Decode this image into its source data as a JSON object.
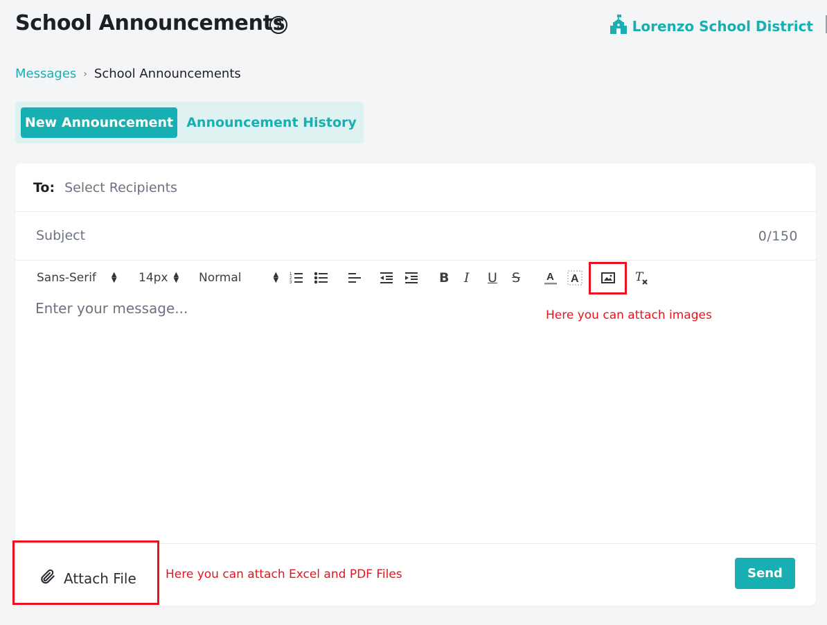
{
  "header": {
    "title": "School Announcements",
    "help_icon": "question-circle-icon",
    "district_name": "Lorenzo School District",
    "district_icon": "school-building-icon"
  },
  "breadcrumb": {
    "parent": "Messages",
    "separator": "›",
    "current": "School Announcements"
  },
  "tabs": [
    {
      "label": "New Announcement",
      "active": true
    },
    {
      "label": "Announcement History",
      "active": false
    }
  ],
  "form": {
    "to_label": "To:",
    "to_placeholder": "Select Recipients",
    "subject_placeholder": "Subject",
    "subject_counter": "0/150",
    "message_placeholder": "Enter your message..."
  },
  "toolbar": {
    "font_family": "Sans-Serif",
    "font_size": "14px",
    "heading": "Normal",
    "icons": [
      "ordered-list-icon",
      "bullet-list-icon",
      "align-left-icon",
      "outdent-icon",
      "indent-icon",
      "bold-icon",
      "italic-icon",
      "underline-icon",
      "strikethrough-icon",
      "font-color-icon",
      "background-color-icon",
      "image-icon",
      "clear-format-icon"
    ]
  },
  "annotations": {
    "image_note": "Here you can attach images",
    "file_note": "Here you can attach Excel and PDF Files"
  },
  "footer": {
    "attach_label": "Attach File",
    "attach_icon": "paperclip-icon",
    "send_label": "Send"
  },
  "colors": {
    "accent": "#17afb1",
    "tab_bg": "#dff2f2",
    "annotation": "#e8121e",
    "page_bg": "#f4f5f7"
  }
}
